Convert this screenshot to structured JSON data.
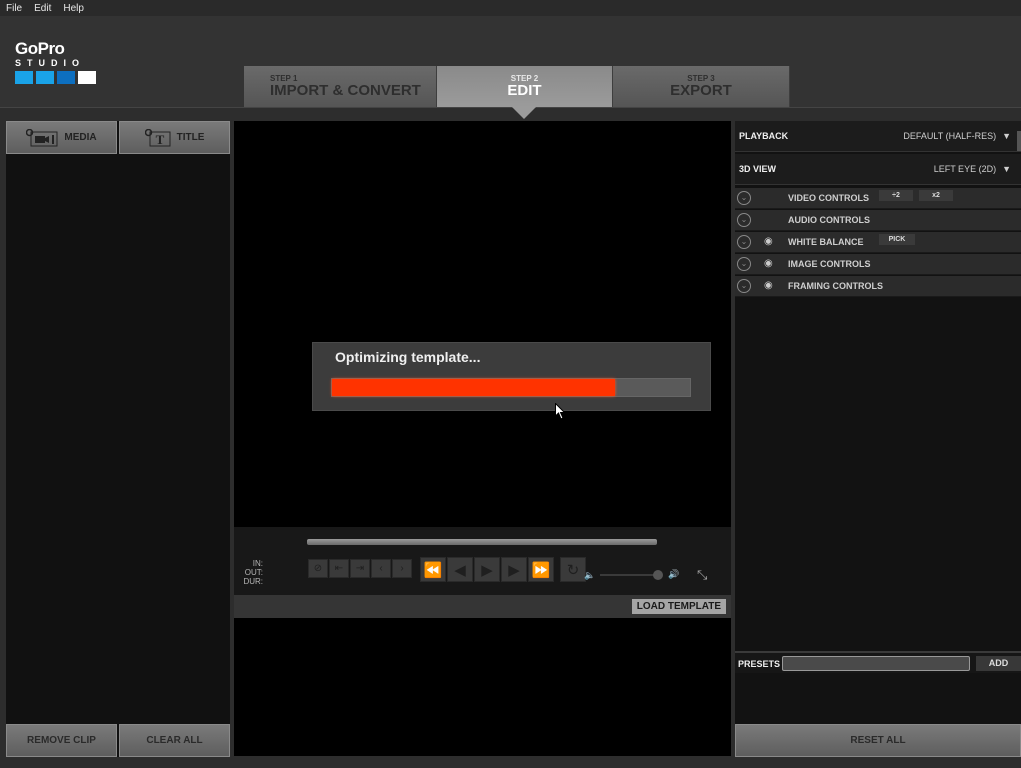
{
  "menu": [
    "File",
    "Edit",
    "Help"
  ],
  "logo": {
    "brand": "GoPro",
    "sub": "STUDIO",
    "squares": [
      "#1aa3e8",
      "#1aa3e8",
      "#0d6fc0",
      "#ffffff"
    ]
  },
  "steps": [
    {
      "num": "STEP 1",
      "label": "IMPORT & CONVERT",
      "active": false
    },
    {
      "num": "STEP 2",
      "label": "EDIT",
      "active": true
    },
    {
      "num": "STEP 3",
      "label": "EXPORT",
      "active": false
    }
  ],
  "left_panel": {
    "tabs": [
      {
        "label": "MEDIA",
        "icon": "add-media-icon"
      },
      {
        "label": "TITLE",
        "icon": "add-title-icon"
      }
    ],
    "remove_clip": "REMOVE CLIP",
    "clear_all": "CLEAR ALL"
  },
  "dialog": {
    "title": "Optimizing template...",
    "progress_percent": 79,
    "progress_color": "#ff3300"
  },
  "transport": {
    "in_label": "IN:",
    "out_label": "OUT:",
    "dur_label": "DUR:",
    "edit_buttons": [
      "razor-icon",
      "mark-in-icon",
      "mark-out-icon",
      "prev-edit-icon",
      "next-edit-icon"
    ],
    "play_buttons": [
      "rewind-icon",
      "step-back-icon",
      "play-icon",
      "step-forward-icon",
      "fast-forward-icon",
      "loop-icon"
    ],
    "volume_percent": 100
  },
  "load_template": "LOAD TEMPLATE",
  "right_panel": {
    "playback": {
      "label": "PLAYBACK",
      "value": "DEFAULT (HALF-RES)"
    },
    "view3d": {
      "label": "3D VIEW",
      "value": "LEFT EYE (2D)"
    },
    "controls": [
      {
        "label": "VIDEO CONTROLS",
        "eye": false,
        "buttons": [
          "÷2",
          "x2"
        ]
      },
      {
        "label": "AUDIO CONTROLS",
        "eye": false,
        "buttons": []
      },
      {
        "label": "WHITE BALANCE",
        "eye": true,
        "buttons": [
          "PICK"
        ]
      },
      {
        "label": "IMAGE CONTROLS",
        "eye": true,
        "buttons": []
      },
      {
        "label": "FRAMING CONTROLS",
        "eye": true,
        "buttons": []
      }
    ],
    "presets_label": "PRESETS",
    "presets_value": "",
    "add": "ADD",
    "reset_all": "RESET ALL"
  }
}
